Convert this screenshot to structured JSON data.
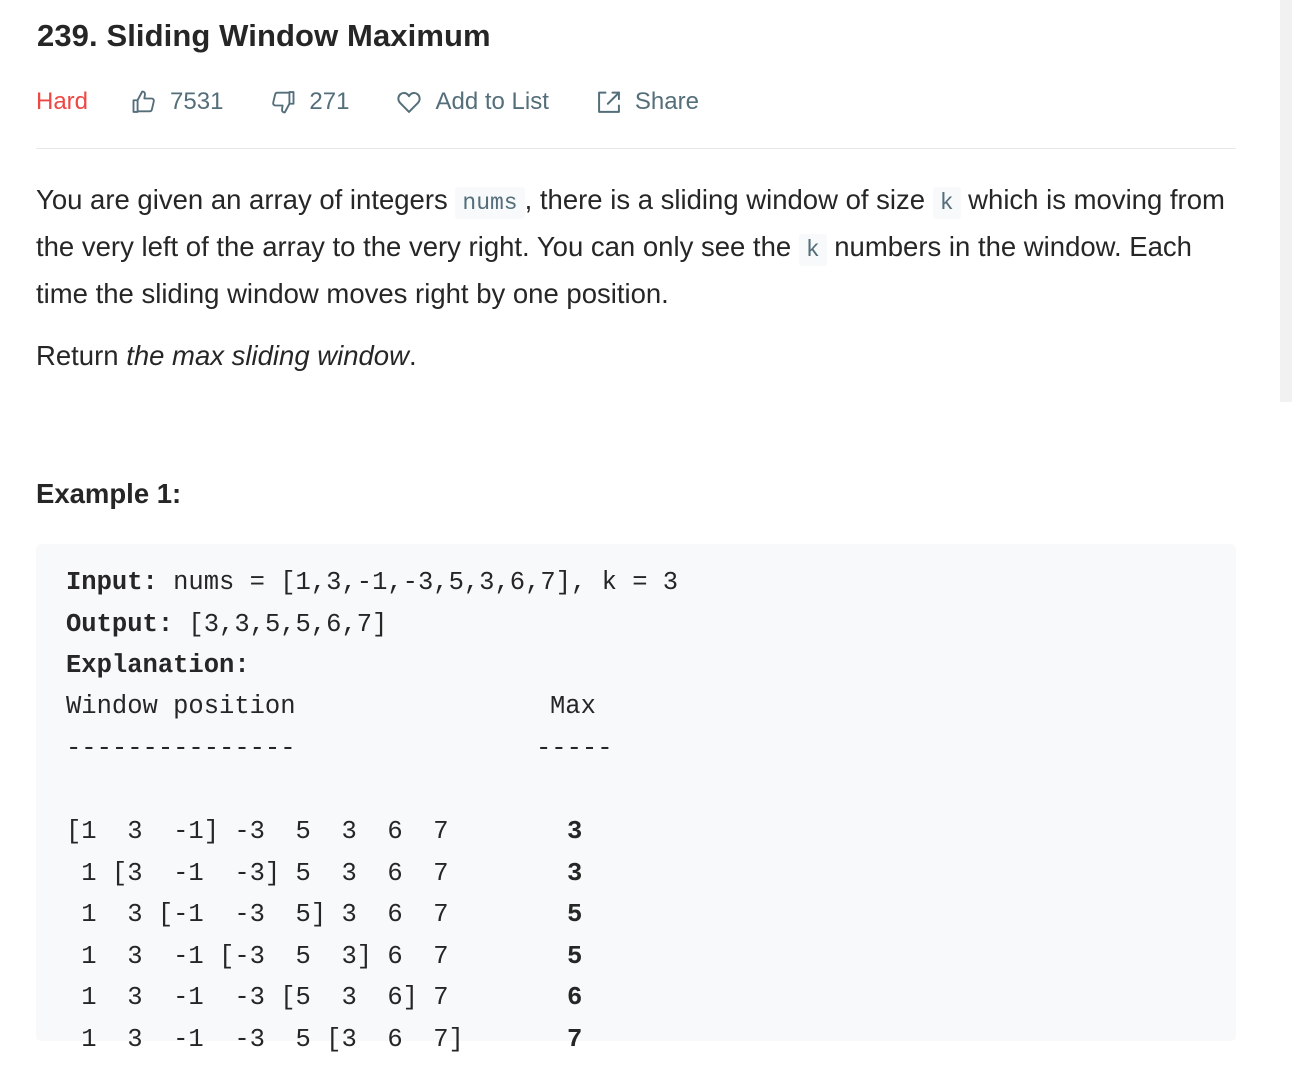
{
  "problem": {
    "title": "239. Sliding Window Maximum",
    "difficulty": "Hard",
    "likes": "7531",
    "dislikes": "271",
    "add_to_list_label": "Add to List",
    "share_label": "Share",
    "difficulty_color": "#ef4743",
    "icons": {
      "likes": "thumbs-up-icon",
      "dislikes": "thumbs-down-icon",
      "add_to_list": "heart-icon",
      "share": "share-icon"
    }
  },
  "description": {
    "p1_part1": "You are given an array of integers ",
    "p1_code1": "nums",
    "p1_part2": ", there is a sliding window of size ",
    "p1_code2": "k",
    "p1_part3": " which is moving from the very left of the array to the very right. You can only see the ",
    "p1_code3": "k",
    "p1_part4": " numbers in the window. Each time the sliding window moves right by one position.",
    "return_prefix": "Return ",
    "return_emph": "the max sliding window",
    "return_suffix": "."
  },
  "example": {
    "title": "Example 1:",
    "input_label": "Input:",
    "input_value": " nums = [1,3,-1,-3,5,3,6,7], k = 3",
    "output_label": "Output:",
    "output_value": " [3,3,5,5,6,7]",
    "explanation_label": "Explanation:",
    "col_window": "Window position",
    "col_max": "Max",
    "dash_window": "---------------",
    "dash_max": "-----",
    "rows": [
      {
        "window": "[1  3  -1] -3  5  3  6  7",
        "max": "3"
      },
      {
        "window": " 1 [3  -1  -3] 5  3  6  7",
        "max": "3"
      },
      {
        "window": " 1  3 [-1  -3  5] 3  6  7",
        "max": "5"
      },
      {
        "window": " 1  3  -1 [-3  5  3] 6  7",
        "max": "5"
      },
      {
        "window": " 1  3  -1  -3 [5  3  6] 7",
        "max": "6"
      },
      {
        "window": " 1  3  -1  -3  5 [3  6  7]",
        "max": "7"
      }
    ]
  }
}
